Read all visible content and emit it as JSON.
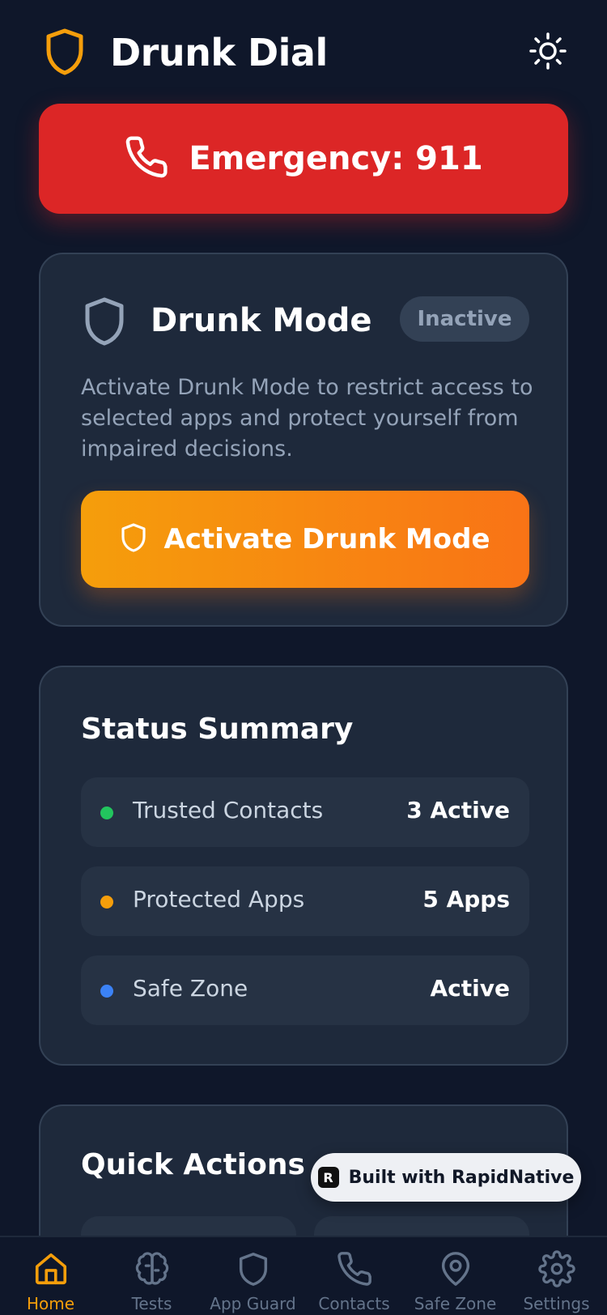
{
  "app": {
    "title": "Drunk Dial"
  },
  "emergency": {
    "label": "Emergency: 911"
  },
  "drunk_mode": {
    "title": "Drunk Mode",
    "status": "Inactive",
    "description": "Activate Drunk Mode to restrict access to selected apps and protect yourself from impaired decisions.",
    "button_label": "Activate Drunk Mode"
  },
  "status_summary": {
    "title": "Status Summary",
    "items": [
      {
        "label": "Trusted Contacts",
        "value": "3 Active",
        "dot_color": "#22c55e"
      },
      {
        "label": "Protected Apps",
        "value": "5 Apps",
        "dot_color": "#f59e0b"
      },
      {
        "label": "Safe Zone",
        "value": "Active",
        "dot_color": "#3b82f6"
      }
    ]
  },
  "quick_actions": {
    "title": "Quick Actions"
  },
  "built_with": {
    "label": "Built with RapidNative"
  },
  "nav": {
    "items": [
      {
        "label": "Home",
        "icon": "home-icon",
        "active": true
      },
      {
        "label": "Tests",
        "icon": "brain-icon",
        "active": false
      },
      {
        "label": "App Guard",
        "icon": "shield-icon",
        "active": false
      },
      {
        "label": "Contacts",
        "icon": "phone-icon",
        "active": false
      },
      {
        "label": "Safe Zone",
        "icon": "location-pin-icon",
        "active": false
      },
      {
        "label": "Settings",
        "icon": "gear-icon",
        "active": false
      }
    ]
  },
  "colors": {
    "background": "#0f172a",
    "card": "#1e293b",
    "accent": "#f59e0b",
    "emergency": "#dc2626",
    "muted_text": "#94a3b8"
  }
}
